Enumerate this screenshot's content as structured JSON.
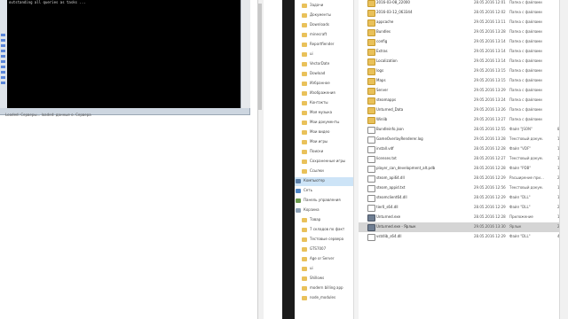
{
  "console": {
    "text": "outstanding all queries as tasks ..."
  },
  "status": {
    "text": "Loaded: Серверы...    loaded: данные о. Сервера"
  },
  "colors": {
    "console_bg": "#000000",
    "divider": "#1b1b1b",
    "folder": "#e9c15a",
    "selection": "#cde4f7"
  },
  "nav": {
    "items": [
      {
        "label": "Задачи",
        "icon": "folder-icon"
      },
      {
        "label": "Документы",
        "icon": "folder-icon"
      },
      {
        "label": "Downloads",
        "icon": "folder-icon"
      },
      {
        "label": "minecraft",
        "icon": "folder-icon"
      },
      {
        "label": "Reportfiender",
        "icon": "folder-icon"
      },
      {
        "label": "ui",
        "icon": "folder-icon"
      },
      {
        "label": "VectorDate",
        "icon": "folder-icon"
      },
      {
        "label": "Dowload",
        "icon": "folder-icon"
      },
      {
        "label": "Избранное",
        "icon": "folder-icon"
      },
      {
        "label": "Изображения",
        "icon": "folder-icon"
      },
      {
        "label": "Контакты",
        "icon": "folder-icon"
      },
      {
        "label": "Моя музыка",
        "icon": "folder-icon"
      },
      {
        "label": "Мои документы",
        "icon": "folder-icon"
      },
      {
        "label": "Мои видео",
        "icon": "folder-icon"
      },
      {
        "label": "Мои игры",
        "icon": "folder-icon"
      },
      {
        "label": "Поиски",
        "icon": "folder-icon"
      },
      {
        "label": "Сохраненные игры",
        "icon": "folder-icon"
      },
      {
        "label": "Ссылки",
        "icon": "folder-icon"
      },
      {
        "label": "Компьютер",
        "icon": "computer-icon"
      },
      {
        "label": "Сеть",
        "icon": "network-icon"
      },
      {
        "label": "Панель управления",
        "icon": "control-panel-icon"
      },
      {
        "label": "Корзина",
        "icon": "recycle-bin-icon"
      },
      {
        "label": "Товар",
        "icon": "folder-icon"
      },
      {
        "label": "7 складов по факт",
        "icon": "folder-icon"
      },
      {
        "label": "Тестовые сервера",
        "icon": "folder-icon"
      },
      {
        "label": "GTS7007",
        "icon": "folder-icon"
      },
      {
        "label": "Age or Server",
        "icon": "folder-icon"
      },
      {
        "label": "ui",
        "icon": "folder-icon"
      },
      {
        "label": "Shillows",
        "icon": "folder-icon"
      },
      {
        "label": "modern billing app",
        "icon": "folder-icon"
      },
      {
        "label": "node_modules",
        "icon": "folder-icon"
      }
    ]
  },
  "files": [
    {
      "name": "2016-03-08_22000",
      "date": "28.05.2016 12:01",
      "type": "Папка с файлами",
      "size": "",
      "kind": "folder"
    },
    {
      "name": "2016-03-12_063344",
      "date": "28.05.2016 12:02",
      "type": "Папка с файлами",
      "size": "",
      "kind": "folder"
    },
    {
      "name": "appcache",
      "date": "29.05.2016 13:11",
      "type": "Папка с файлами",
      "size": "",
      "kind": "folder"
    },
    {
      "name": "Bundles",
      "date": "29.05.2016 13:28",
      "type": "Папка с файлами",
      "size": "",
      "kind": "folder"
    },
    {
      "name": "config",
      "date": "29.05.2016 13:14",
      "type": "Папка с файлами",
      "size": "",
      "kind": "folder"
    },
    {
      "name": "Extras",
      "date": "29.05.2016 13:14",
      "type": "Папка с файлами",
      "size": "",
      "kind": "folder"
    },
    {
      "name": "Localization",
      "date": "29.05.2016 13:14",
      "type": "Папка с файлами",
      "size": "",
      "kind": "folder"
    },
    {
      "name": "logs",
      "date": "29.05.2016 13:15",
      "type": "Папка с файлами",
      "size": "",
      "kind": "folder"
    },
    {
      "name": "Maps",
      "date": "29.05.2016 13:15",
      "type": "Папка с файлами",
      "size": "",
      "kind": "folder"
    },
    {
      "name": "Server",
      "date": "29.05.2016 13:29",
      "type": "Папка с файлами",
      "size": "",
      "kind": "folder"
    },
    {
      "name": "steamapps",
      "date": "29.05.2016 13:24",
      "type": "Папка с файлами",
      "size": "",
      "kind": "folder"
    },
    {
      "name": "Unturned_Data",
      "date": "29.05.2016 13:26",
      "type": "Папка с файлами",
      "size": "",
      "kind": "folder"
    },
    {
      "name": "Winlib",
      "date": "29.05.2016 13:27",
      "type": "Папка с файлами",
      "size": "",
      "kind": "folder"
    },
    {
      "name": "Bundleinfo.json",
      "date": "28.05.2016 12:55",
      "type": "Файл \"JSON\"",
      "size": "88 КБ",
      "kind": "file"
    },
    {
      "name": "GameOverlayRenderer.log",
      "date": "29.05.2016 13:28",
      "type": "Текстовый докум.",
      "size": "1 КБ",
      "kind": "file"
    },
    {
      "name": "install.vdf",
      "date": "28.05.2016 12:28",
      "type": "Файл \"VDF\"",
      "size": "1 КБ",
      "kind": "file"
    },
    {
      "name": "licenses.txt",
      "date": "28.05.2016 12:27",
      "type": "Текстовый докум.",
      "size": "17 КБ",
      "kind": "file"
    },
    {
      "name": "player_can_development_alt.pdb",
      "date": "28.05.2016 12:28",
      "type": "Файл \"PDB\"",
      "size": "12 051 КБ",
      "kind": "file"
    },
    {
      "name": "steam_api64.dll",
      "date": "28.05.2016 12:29",
      "type": "Расширение при...",
      "size": "215 КБ",
      "kind": "file"
    },
    {
      "name": "steam_appid.txt",
      "date": "29.05.2016 12:56",
      "type": "Текстовый докум.",
      "size": "1 КБ",
      "kind": "file"
    },
    {
      "name": "steamclient64.dll",
      "date": "28.05.2016 12:29",
      "type": "Файл \"DLL\"",
      "size": "14 298 КБ",
      "kind": "file"
    },
    {
      "name": "tier0_s64.dll",
      "date": "28.05.2016 12:29",
      "type": "Файл \"DLL\"",
      "size": "285 КБ",
      "kind": "file"
    },
    {
      "name": "Unturned.exe",
      "date": "28.05.2016 12:28",
      "type": "Приложение",
      "size": "16 025 КБ",
      "kind": "exe"
    },
    {
      "name": "Unturned.exe - Ярлык",
      "date": "29.05.2016 13:30",
      "type": "Ярлык",
      "size": "2 КБ",
      "kind": "exe"
    },
    {
      "name": "vstdlib_s64.dll",
      "date": "28.05.2016 12:29",
      "type": "Файл \"DLL\"",
      "size": "423 КБ",
      "kind": "file"
    }
  ]
}
